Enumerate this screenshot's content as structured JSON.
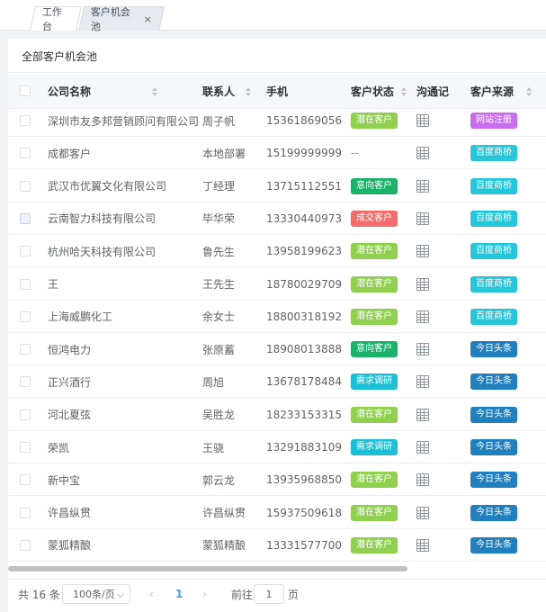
{
  "tabs": [
    {
      "label": "工作台"
    },
    {
      "label": "客户机会池",
      "close": "×"
    }
  ],
  "card_title": "全部客户机会池",
  "columns": [
    "公司名称",
    "联系人",
    "手机",
    "客户状态",
    "沟通记",
    "客户来源"
  ],
  "status_colors": {
    "潜在客户": "#8fd14f",
    "意向客户": "#19b369",
    "成交客户": "#f56c6c",
    "需求调研": "#1cc0d6"
  },
  "source_colors": {
    "网站注册": "#c86cf0",
    "百度商桥": "#26c6da",
    "今日头条": "#1f7fbf"
  },
  "rows": [
    {
      "company": "深圳市友多邦营销顾问有限公司",
      "contact": "周子帆",
      "phone": "15361869056",
      "status": "潜在客户",
      "source": "网站注册"
    },
    {
      "company": "成都客户",
      "contact": "本地部署",
      "phone": "15199999999",
      "status": "--",
      "source": "百度商桥"
    },
    {
      "company": "武汉市优翼文化有限公司",
      "contact": "丁经理",
      "phone": "13715112551",
      "status": "意向客户",
      "source": "百度商桥"
    },
    {
      "company": "云南智力科技有限公司",
      "contact": "毕华荣",
      "phone": "13330440973",
      "status": "成交客户",
      "source": "百度商桥"
    },
    {
      "company": "杭州哈天科技有限公司",
      "contact": "鲁先生",
      "phone": "13958199623",
      "status": "潜在客户",
      "source": "百度商桥"
    },
    {
      "company": "王",
      "contact": "王先生",
      "phone": "18780029709",
      "status": "潜在客户",
      "source": "百度商桥"
    },
    {
      "company": "上海威鹏化工",
      "contact": "余女士",
      "phone": "18800318192",
      "status": "潜在客户",
      "source": "百度商桥"
    },
    {
      "company": "恒鸿电力",
      "contact": "张原蓄",
      "phone": "18908013888",
      "status": "意向客户",
      "source": "今日头条"
    },
    {
      "company": "正兴酒行",
      "contact": "周旭",
      "phone": "13678178484",
      "status": "需求调研",
      "source": "今日头条"
    },
    {
      "company": "河北夏弦",
      "contact": "吴胜龙",
      "phone": "18233153315",
      "status": "潜在客户",
      "source": "今日头条"
    },
    {
      "company": "荣凯",
      "contact": "王骁",
      "phone": "13291883109",
      "status": "需求调研",
      "source": "今日头条"
    },
    {
      "company": "新中宝",
      "contact": "郭云龙",
      "phone": "13935968850",
      "status": "潜在客户",
      "source": "今日头条"
    },
    {
      "company": "许昌纵贯",
      "contact": "许昌纵贯",
      "phone": "15937509618",
      "status": "潜在客户",
      "source": "今日头条"
    },
    {
      "company": "蒙狐精酿",
      "contact": "蒙狐精酿",
      "phone": "13331577700",
      "status": "潜在客户",
      "source": "今日头条"
    }
  ],
  "pager": {
    "total": "共 16 条",
    "page_size": "100条/页",
    "prev": "‹",
    "current": "1",
    "next": "›",
    "goto_prefix": "前往",
    "goto_value": "1",
    "goto_suffix": "页"
  }
}
